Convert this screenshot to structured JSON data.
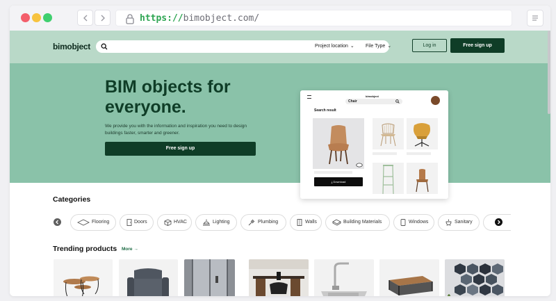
{
  "browser": {
    "url_protocol": "https://",
    "url_host": "bimobject.com/"
  },
  "header": {
    "logo": "bimobject",
    "dropdowns": [
      {
        "label": "Project location"
      },
      {
        "label": "File Type"
      }
    ],
    "login_label": "Log in",
    "signup_label": "Free sign up"
  },
  "hero": {
    "title_line1": "BIM objects for",
    "title_line2": "everyone.",
    "subtitle": "We provide you with the information and inspiration you need to design buildings faster, smarter and greener.",
    "cta_label": "Free sign up"
  },
  "mock_app": {
    "logo": "bimobject",
    "search_value": "Chair",
    "results_label": "Search result",
    "download_label": "Download"
  },
  "categories": {
    "heading": "Categories",
    "items": [
      {
        "label": "Flooring",
        "icon": "flooring-icon"
      },
      {
        "label": "Doors",
        "icon": "door-icon"
      },
      {
        "label": "HVAC",
        "icon": "hvac-icon"
      },
      {
        "label": "Lighting",
        "icon": "lighting-icon"
      },
      {
        "label": "Plumbing",
        "icon": "plumbing-icon"
      },
      {
        "label": "Walls",
        "icon": "wall-icon"
      },
      {
        "label": "Building Materials",
        "icon": "building-materials-icon"
      },
      {
        "label": "Windows",
        "icon": "window-icon"
      },
      {
        "label": "Sanitary",
        "icon": "sanitary-icon"
      }
    ]
  },
  "trending": {
    "heading": "Trending products",
    "more_label": "More →"
  },
  "colors": {
    "header_bg": "#b9d9c8",
    "hero_bg": "#8ac2a9",
    "brand_dark": "#0f3d27",
    "url_green": "#2ea552"
  }
}
